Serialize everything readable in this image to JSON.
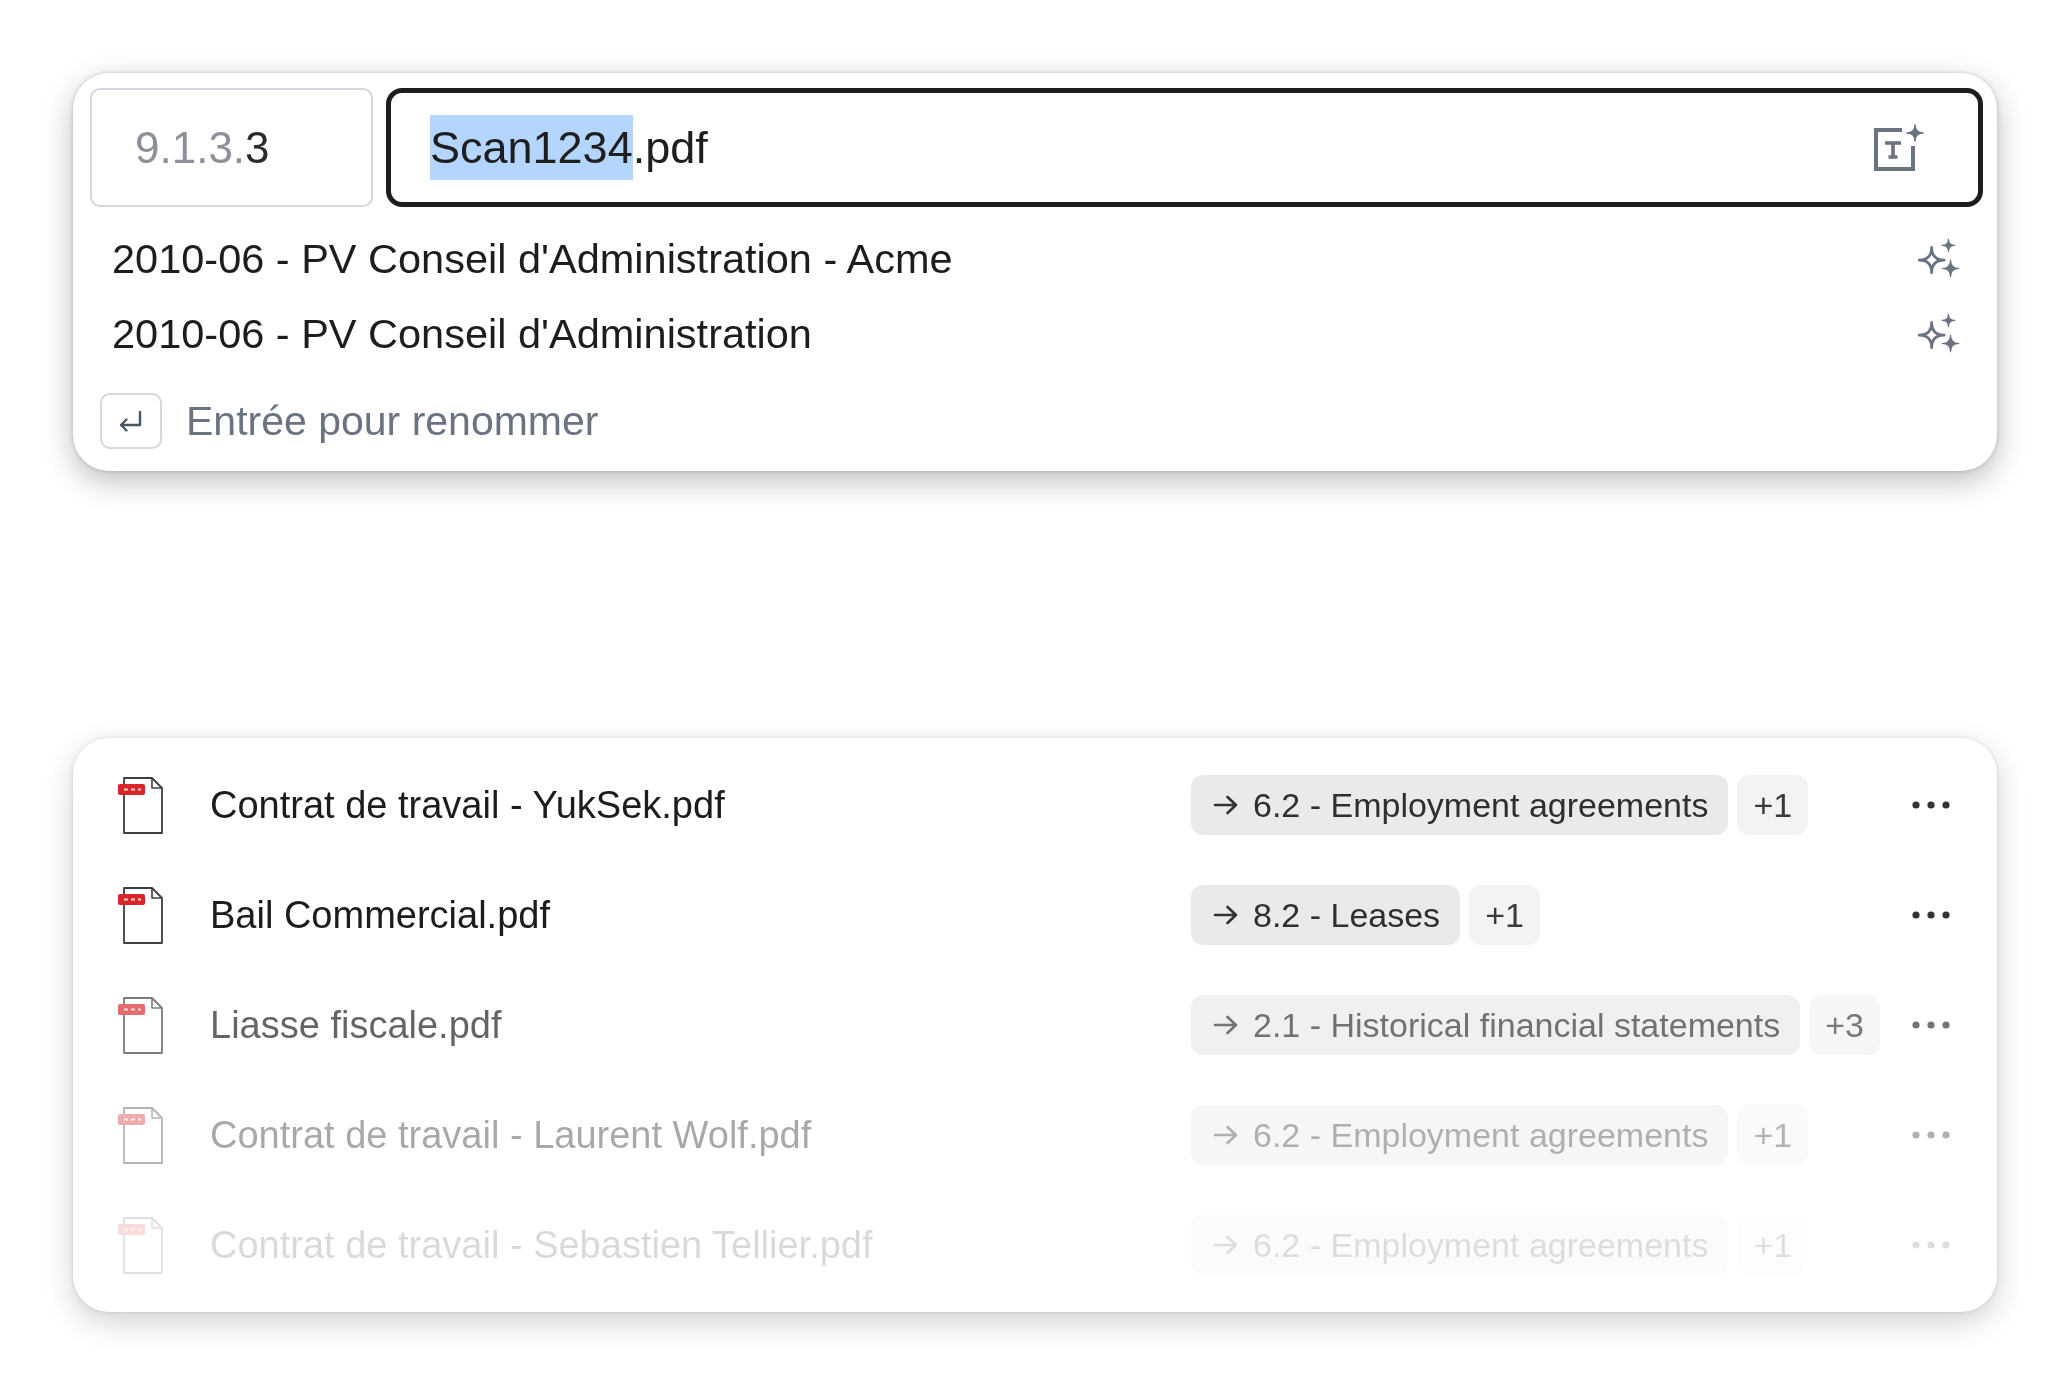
{
  "rename_dialog": {
    "index": {
      "prefix": "9.1.3.",
      "number": "3"
    },
    "filename": {
      "selected_part": "Scan1234",
      "rest": ".pdf"
    },
    "suggestions": [
      "2010-06 - PV Conseil d'Administration - Acme",
      "2010-06 - PV Conseil d'Administration"
    ],
    "hint": "Entrée pour renommer"
  },
  "file_list": {
    "files": [
      {
        "name": "Contrat de travail - YukSek.pdf",
        "destination": "6.2 - Employment agreements",
        "extra_count": "+1"
      },
      {
        "name": "Bail Commercial.pdf",
        "destination": "8.2 - Leases",
        "extra_count": "+1"
      },
      {
        "name": "Liasse fiscale.pdf",
        "destination": "2.1 - Historical financial statements",
        "extra_count": "+3"
      },
      {
        "name": "Contrat de travail - Laurent Wolf.pdf",
        "destination": "6.2 - Employment agreements",
        "extra_count": "+1"
      },
      {
        "name": "Contrat de travail - Sebastien Tellier.pdf",
        "destination": "6.2 - Employment agreements",
        "extra_count": "+1"
      }
    ]
  }
}
